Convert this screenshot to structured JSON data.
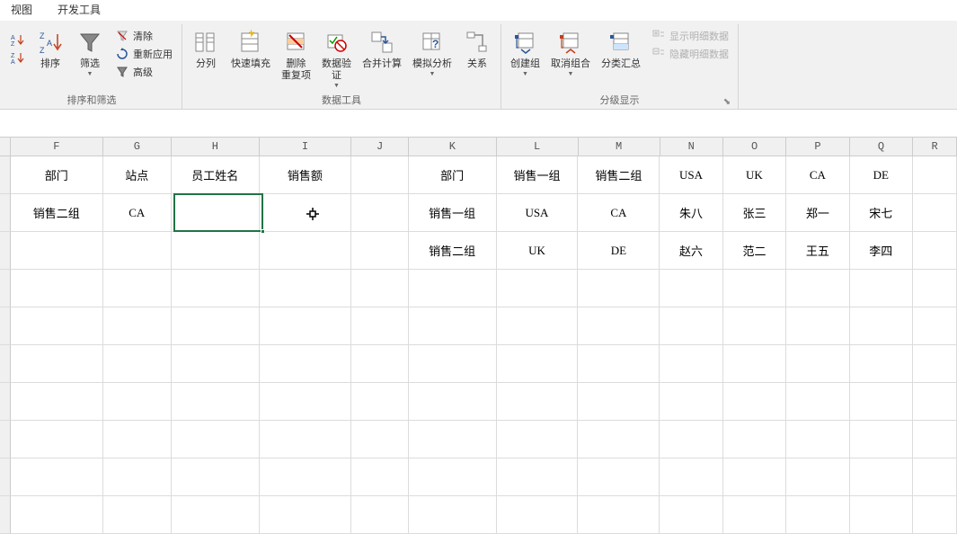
{
  "tabs": {
    "view": "视图",
    "developer": "开发工具"
  },
  "ribbon": {
    "sort_filter": {
      "label": "排序和筛选",
      "sort_asc": "A↓Z",
      "sort_desc": "Z↓A",
      "sort_btn": "排序",
      "filter_btn": "筛选",
      "clear": "清除",
      "reapply": "重新应用",
      "advanced": "高级"
    },
    "data_tools": {
      "label": "数据工具",
      "text_to_columns": "分列",
      "flash_fill": "快速填充",
      "remove_dup": "删除\n重复项",
      "validation": "数据验\n证",
      "consolidate": "合并计算",
      "whatif": "模拟分析",
      "relationships": "关系"
    },
    "outline": {
      "label": "分级显示",
      "group": "创建组",
      "ungroup": "取消组合",
      "subtotal": "分类汇总",
      "show_detail": "显示明细数据",
      "hide_detail": "隐藏明细数据"
    }
  },
  "columns": [
    "F",
    "G",
    "H",
    "I",
    "J",
    "K",
    "L",
    "M",
    "N",
    "O",
    "P",
    "Q",
    "R"
  ],
  "grid": {
    "r1": {
      "F": "部门",
      "G": "站点",
      "H": "员工姓名",
      "I": "销售额",
      "J": "",
      "K": "部门",
      "L": "销售一组",
      "M": "销售二组",
      "N": "USA",
      "O": "UK",
      "P": "CA",
      "Q": "DE",
      "R": ""
    },
    "r2": {
      "F": "销售二组",
      "G": "CA",
      "H": "",
      "I": "",
      "J": "",
      "K": "销售一组",
      "L": "USA",
      "M": "CA",
      "N": "朱八",
      "O": "张三",
      "P": "郑一",
      "Q": "宋七",
      "R": ""
    },
    "r3": {
      "F": "",
      "G": "",
      "H": "",
      "I": "",
      "J": "",
      "K": "销售二组",
      "L": "UK",
      "M": "DE",
      "N": "赵六",
      "O": "范二",
      "P": "王五",
      "Q": "李四",
      "R": ""
    }
  },
  "selected_cell": "H2",
  "colors": {
    "selection": "#217346"
  }
}
